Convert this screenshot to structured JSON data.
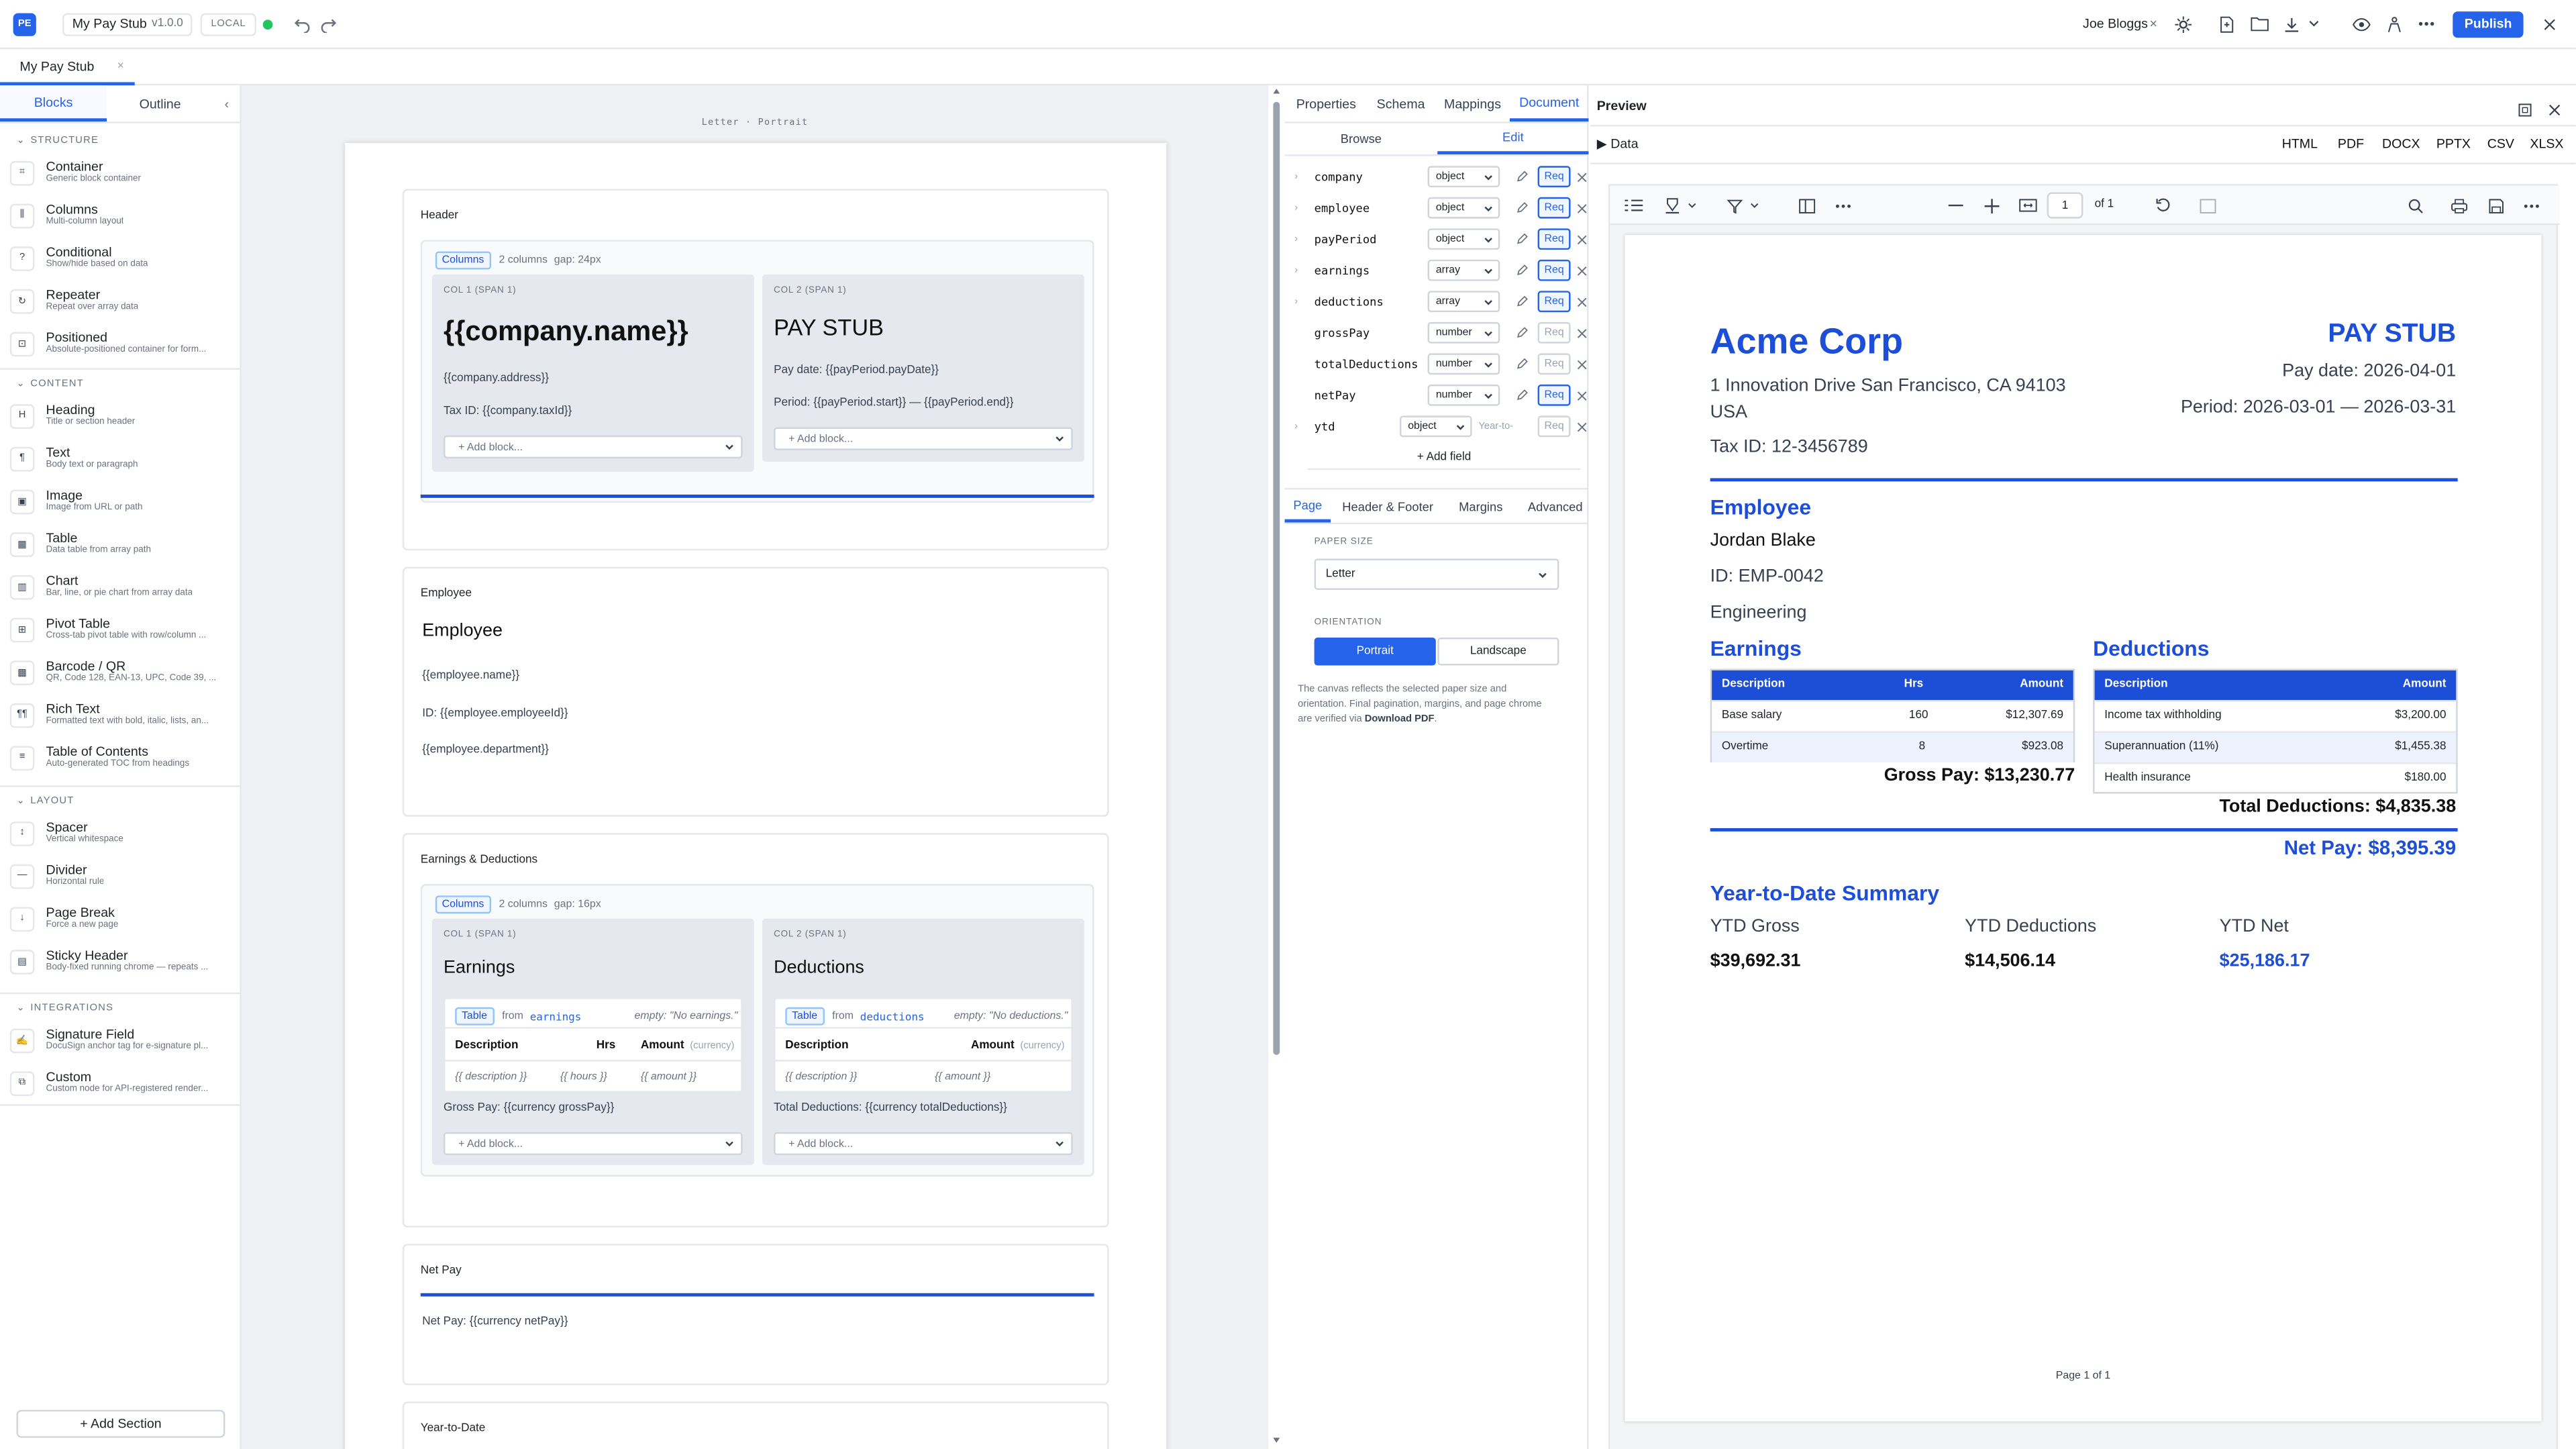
{
  "app": {
    "initials": "PE",
    "title": "My Pay Stub",
    "version": "v1.0.0",
    "mode": "LOCAL",
    "user": "Joe Bloggs",
    "publish_label": "Publish",
    "colors": {
      "accent": "#2563eb",
      "status_online": "#22c55e"
    }
  },
  "tabs": [
    {
      "label": "My Pay Stub",
      "close": "×"
    }
  ],
  "sidebar": {
    "tabs": [
      "Blocks",
      "Outline"
    ],
    "collapse_icon": "‹",
    "groups": [
      {
        "title": "STRUCTURE",
        "items": [
          {
            "icon": "⌗",
            "label": "Container",
            "desc": "Generic block container"
          },
          {
            "icon": "⫼",
            "label": "Columns",
            "desc": "Multi-column layout"
          },
          {
            "icon": "?",
            "label": "Conditional",
            "desc": "Show/hide based on data"
          },
          {
            "icon": "↻",
            "label": "Repeater",
            "desc": "Repeat over array data"
          },
          {
            "icon": "⊡",
            "label": "Positioned",
            "desc": "Absolute-positioned container for form..."
          }
        ]
      },
      {
        "title": "CONTENT",
        "items": [
          {
            "icon": "H",
            "label": "Heading",
            "desc": "Title or section header"
          },
          {
            "icon": "¶",
            "label": "Text",
            "desc": "Body text or paragraph"
          },
          {
            "icon": "▣",
            "label": "Image",
            "desc": "Image from URL or path"
          },
          {
            "icon": "▦",
            "label": "Table",
            "desc": "Data table from array path"
          },
          {
            "icon": "▥",
            "label": "Chart",
            "desc": "Bar, line, or pie chart from array data"
          },
          {
            "icon": "⊞",
            "label": "Pivot Table",
            "desc": "Cross-tab pivot table with row/column ..."
          },
          {
            "icon": "▩",
            "label": "Barcode / QR",
            "desc": "QR, Code 128, EAN-13, UPC, Code 39, ..."
          },
          {
            "icon": "¶¶",
            "label": "Rich Text",
            "desc": "Formatted text with bold, italic, lists, an..."
          },
          {
            "icon": "≡",
            "label": "Table of Contents",
            "desc": "Auto-generated TOC from headings"
          }
        ]
      },
      {
        "title": "LAYOUT",
        "items": [
          {
            "icon": "↕",
            "label": "Spacer",
            "desc": "Vertical whitespace"
          },
          {
            "icon": "—",
            "label": "Divider",
            "desc": "Horizontal rule"
          },
          {
            "icon": "↓",
            "label": "Page Break",
            "desc": "Force a new page"
          },
          {
            "icon": "▤",
            "label": "Sticky Header",
            "desc": "Body-fixed running chrome — repeats ..."
          }
        ]
      },
      {
        "title": "INTEGRATIONS",
        "items": [
          {
            "icon": "✍",
            "label": "Signature Field",
            "desc": "DocuSign anchor tag for e-signature pl..."
          },
          {
            "icon": "⧉",
            "label": "Custom",
            "desc": "Custom node for API-registered render..."
          }
        ]
      }
    ],
    "add_section": "+ Add Section"
  },
  "canvas": {
    "paper_label": "Letter · Portrait",
    "header": {
      "title": "Header",
      "columns_badge": "Columns",
      "columns_count": "2 columns",
      "columns_gap": "gap: 24px",
      "col1": {
        "label": "COL 1 (SPAN 1)",
        "heading": "{{company.name}}",
        "line1": "{{company.address}}",
        "line2": "Tax ID: {{company.taxId}}"
      },
      "col2": {
        "label": "COL 2 (SPAN 1)",
        "heading": "PAY STUB",
        "line1": "Pay date: {{payPeriod.payDate}}",
        "line2": "Period: {{payPeriod.start}} — {{payPeriod.end}}"
      },
      "add_block": "+ Add block..."
    },
    "employee": {
      "title": "Employee",
      "heading": "Employee",
      "line1": "{{employee.name}}",
      "line2": "ID: {{employee.employeeId}}",
      "line3": "{{employee.department}}"
    },
    "earnings_deductions": {
      "title": "Earnings & Deductions",
      "columns_badge": "Columns",
      "columns_count": "2 columns",
      "columns_gap": "gap: 16px",
      "col1": {
        "label": "COL 1 (SPAN 1)",
        "heading": "Earnings",
        "table_badge": "Table",
        "from": "from",
        "source": "earnings",
        "empty": "empty: \"No earnings.\"",
        "headers": [
          "Description",
          "Hrs",
          "Amount"
        ],
        "unit": "(currency)",
        "cells": [
          "{{ description }}",
          "{{ hours }}",
          "{{ amount }}"
        ],
        "total": "Gross Pay: {{currency grossPay}}"
      },
      "col2": {
        "label": "COL 2 (SPAN 1)",
        "heading": "Deductions",
        "table_badge": "Table",
        "from": "from",
        "source": "deductions",
        "empty": "empty: \"No deductions.\"",
        "headers": [
          "Description",
          "Amount"
        ],
        "unit": "(currency)",
        "cells": [
          "{{ description }}",
          "{{ amount }}"
        ],
        "total": "Total Deductions: {{currency totalDeductions}}"
      },
      "add_block": "+ Add block..."
    },
    "net_pay": {
      "title": "Net Pay",
      "line": "Net Pay: {{currency netPay}}"
    },
    "ytd": {
      "title": "Year-to-Date"
    }
  },
  "properties": {
    "tabs": [
      "Properties",
      "Schema",
      "Mappings",
      "Document"
    ],
    "active_tab": "Document",
    "subtabs": [
      "Browse",
      "Edit"
    ],
    "fields": [
      {
        "name": "company",
        "type": "object",
        "req": true
      },
      {
        "name": "employee",
        "type": "object",
        "req": true
      },
      {
        "name": "payPeriod",
        "type": "object",
        "req": true
      },
      {
        "name": "earnings",
        "type": "array",
        "req": true
      },
      {
        "name": "deductions",
        "type": "array",
        "req": true
      },
      {
        "name": "grossPay",
        "type": "number",
        "req": false
      },
      {
        "name": "totalDeductions",
        "type": "number",
        "req": false
      },
      {
        "name": "netPay",
        "type": "number",
        "req": true
      },
      {
        "name": "ytd",
        "type": "object",
        "req": false,
        "placeholder": "Year-to-"
      }
    ],
    "req_label": "Req",
    "add_field": "+ Add field",
    "page_tabs": [
      "Page",
      "Header & Footer",
      "Margins",
      "Advanced"
    ],
    "paper_size_label": "PAPER SIZE",
    "paper_size": "Letter",
    "orientation_label": "ORIENTATION",
    "orientations": [
      "Portrait",
      "Landscape"
    ],
    "help_1": "The canvas reflects the selected paper size and",
    "help_2": "orientation. Final pagination, margins, and page chrome",
    "help_3": "are verified via",
    "help_link": "Download PDF",
    "help_end": "."
  },
  "preview": {
    "title": "Preview",
    "data_toggle": "▶ Data",
    "formats": [
      "HTML",
      "PDF",
      "DOCX",
      "PPTX",
      "CSV",
      "XLSX"
    ],
    "page_num": "1",
    "page_of": "of 1",
    "doc": {
      "company": "Acme Corp",
      "address": "1 Innovation Drive San Francisco, CA 94103",
      "country": "USA",
      "tax_id": "Tax ID: 12-3456789",
      "doc_title": "PAY STUB",
      "pay_date": "Pay date: 2026-04-01",
      "period": "Period: 2026-03-01 — 2026-03-31",
      "employee_heading": "Employee",
      "employee_name": "Jordan Blake",
      "employee_id": "ID: EMP-0042",
      "department": "Engineering",
      "earnings_heading": "Earnings",
      "earnings_headers": [
        "Description",
        "Hrs",
        "Amount"
      ],
      "earnings_rows": [
        [
          "Base salary",
          "160",
          "$12,307.69"
        ],
        [
          "Overtime",
          "8",
          "$923.08"
        ]
      ],
      "gross_pay": "Gross Pay: $13,230.77",
      "deductions_heading": "Deductions",
      "deductions_headers": [
        "Description",
        "Amount"
      ],
      "deductions_rows": [
        [
          "Income tax withholding",
          "$3,200.00"
        ],
        [
          "Superannuation (11%)",
          "$1,455.38"
        ],
        [
          "Health insurance",
          "$180.00"
        ]
      ],
      "total_deductions": "Total Deductions: $4,835.38",
      "net_pay": "Net Pay: $8,395.39",
      "ytd_heading": "Year-to-Date Summary",
      "ytd_labels": [
        "YTD Gross",
        "YTD Deductions",
        "YTD Net"
      ],
      "ytd_values": [
        "$39,692.31",
        "$14,506.14",
        "$25,186.17"
      ],
      "footer": "Page 1 of 1"
    }
  }
}
